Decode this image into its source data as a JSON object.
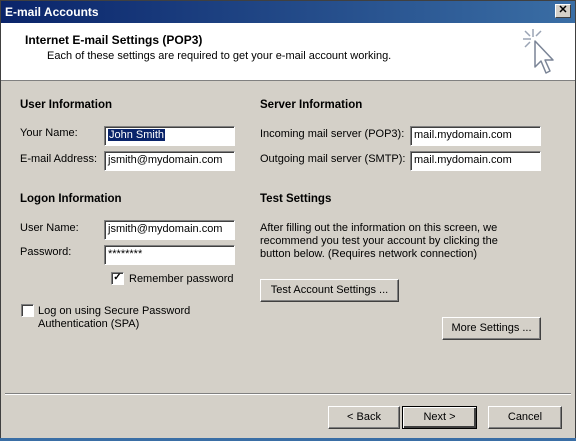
{
  "window": {
    "title": "E-mail Accounts",
    "close_glyph": "✕"
  },
  "header": {
    "title": "Internet E-mail Settings (POP3)",
    "subtitle": "Each of these settings are required to get your e-mail account working.",
    "icon": "wizard-cursor-icon"
  },
  "user_info": {
    "heading": "User Information",
    "name_label": "Your Name:",
    "name_value": "John Smith",
    "email_label": "E-mail Address:",
    "email_value": "jsmith@mydomain.com"
  },
  "server_info": {
    "heading": "Server Information",
    "incoming_label": "Incoming mail server (POP3):",
    "incoming_value": "mail.mydomain.com",
    "outgoing_label": "Outgoing mail server (SMTP):",
    "outgoing_value": "mail.mydomain.com"
  },
  "logon_info": {
    "heading": "Logon Information",
    "user_label": "User Name:",
    "user_value": "jsmith@mydomain.com",
    "password_label": "Password:",
    "password_value": "********",
    "remember_label": "Remember password",
    "remember_checked": true,
    "remember_glyph": "✓",
    "spa_label_line1": "Log on using Secure Password",
    "spa_label_line2": "Authentication (SPA)",
    "spa_checked": false
  },
  "test_settings": {
    "heading": "Test Settings",
    "desc_line1": "After filling out the information on this screen, we",
    "desc_line2": "recommend you test your account by clicking the",
    "desc_line3": "button below. (Requires network connection)",
    "test_button": "Test Account Settings ..."
  },
  "more_settings_button": "More Settings ...",
  "footer": {
    "back": "< Back",
    "next": "Next >",
    "cancel": "Cancel"
  }
}
